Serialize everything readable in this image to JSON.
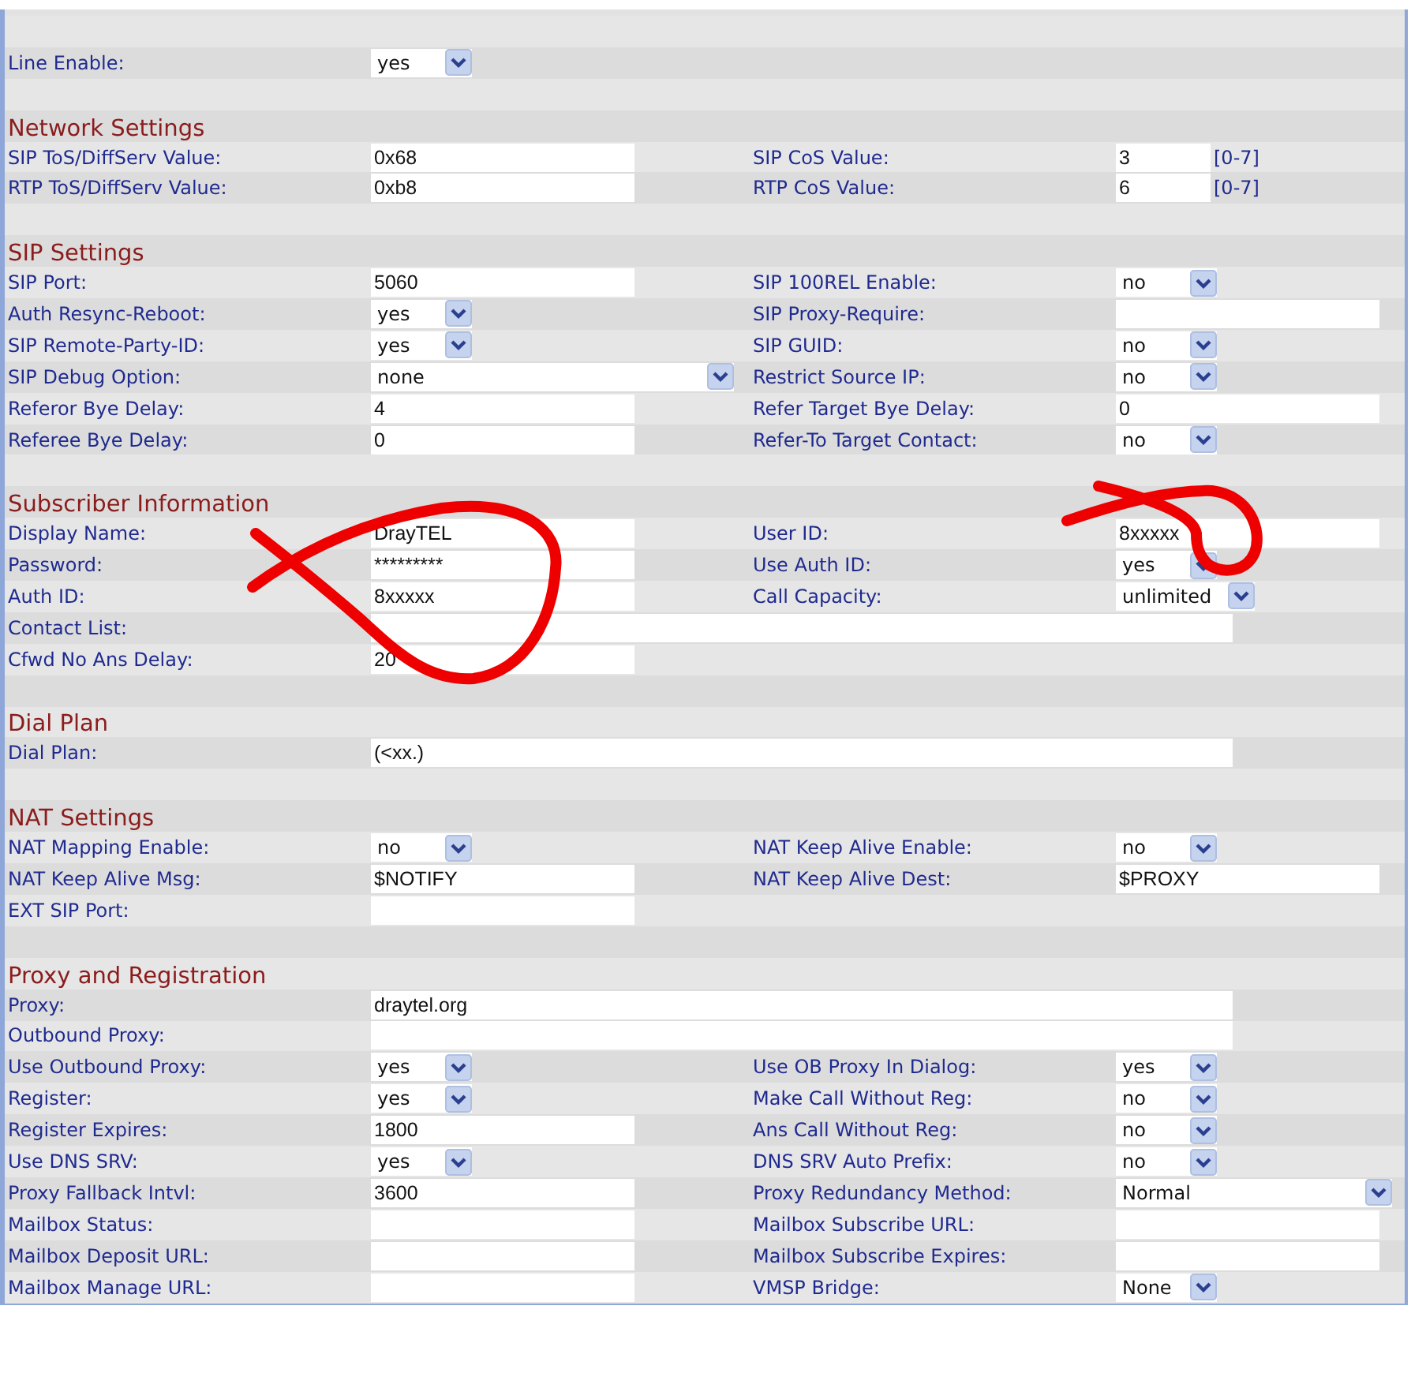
{
  "sections": [
    {
      "rows": [
        {
          "left": {
            "label": "Line Enable:",
            "control": {
              "kind": "select",
              "value": "yes"
            }
          }
        }
      ]
    },
    {
      "title": "Network Settings",
      "rows": [
        {
          "left": {
            "label": "SIP ToS/DiffServ Value:",
            "control": {
              "kind": "text",
              "value": "0x68"
            }
          },
          "right": {
            "label": "SIP CoS Value:",
            "control": {
              "kind": "text-short",
              "value": "3",
              "suffix": "[0-7]"
            }
          }
        },
        {
          "left": {
            "label": "RTP ToS/DiffServ Value:",
            "control": {
              "kind": "text",
              "value": "0xb8"
            }
          },
          "right": {
            "label": "RTP CoS Value:",
            "control": {
              "kind": "text-short",
              "value": "6",
              "suffix": "[0-7]"
            }
          }
        }
      ]
    },
    {
      "title": "SIP Settings",
      "rows": [
        {
          "left": {
            "label": "SIP Port:",
            "control": {
              "kind": "text",
              "value": "5060"
            }
          },
          "right": {
            "label": "SIP 100REL Enable:",
            "control": {
              "kind": "select",
              "value": "no"
            }
          }
        },
        {
          "left": {
            "label": "Auth Resync-Reboot:",
            "control": {
              "kind": "select",
              "value": "yes"
            }
          },
          "right": {
            "label": "SIP Proxy-Require:",
            "control": {
              "kind": "text"
            }
          }
        },
        {
          "left": {
            "label": "SIP Remote-Party-ID:",
            "control": {
              "kind": "select",
              "value": "yes"
            }
          },
          "right": {
            "label": "SIP GUID:",
            "control": {
              "kind": "select",
              "value": "no"
            }
          }
        },
        {
          "left": {
            "label": "SIP Debug Option:",
            "control": {
              "kind": "select-long",
              "value": "none"
            }
          },
          "right": {
            "label": "Restrict Source IP:",
            "control": {
              "kind": "select",
              "value": "no"
            }
          }
        },
        {
          "left": {
            "label": "Referor Bye Delay:",
            "control": {
              "kind": "text",
              "value": "4"
            }
          },
          "right": {
            "label": "Refer Target Bye Delay:",
            "control": {
              "kind": "text",
              "value": "0"
            }
          }
        },
        {
          "left": {
            "label": "Referee Bye Delay:",
            "control": {
              "kind": "text",
              "value": "0"
            }
          },
          "right": {
            "label": "Refer-To Target Contact:",
            "control": {
              "kind": "select",
              "value": "no"
            }
          }
        }
      ]
    },
    {
      "title": "Subscriber Information",
      "rows": [
        {
          "left": {
            "label": "Display Name:",
            "control": {
              "kind": "text",
              "value": "DrayTEL"
            }
          },
          "right": {
            "label": "User ID:",
            "control": {
              "kind": "text",
              "value": "8xxxxx"
            }
          }
        },
        {
          "left": {
            "label": "Password:",
            "control": {
              "kind": "text",
              "value": "*********"
            }
          },
          "right": {
            "label": "Use Auth ID:",
            "control": {
              "kind": "select",
              "value": "yes"
            }
          }
        },
        {
          "left": {
            "label": "Auth ID:",
            "control": {
              "kind": "text",
              "value": "8xxxxx"
            }
          },
          "right": {
            "label": "Call Capacity:",
            "control": {
              "kind": "select",
              "value": "unlimited"
            }
          }
        },
        {
          "left": {
            "label": "Contact List:",
            "control": {
              "kind": "text-long"
            }
          }
        },
        {
          "left": {
            "label": "Cfwd No Ans Delay:",
            "control": {
              "kind": "text",
              "value": "20"
            }
          }
        }
      ]
    },
    {
      "title": "Dial Plan",
      "rows": [
        {
          "left": {
            "label": "Dial Plan:",
            "control": {
              "kind": "text-long",
              "value": "(<xx.)"
            }
          }
        }
      ]
    },
    {
      "title": "NAT Settings",
      "rows": [
        {
          "left": {
            "label": "NAT Mapping Enable:",
            "control": {
              "kind": "select",
              "value": "no"
            }
          },
          "right": {
            "label": "NAT Keep Alive Enable:",
            "control": {
              "kind": "select",
              "value": "no"
            }
          }
        },
        {
          "left": {
            "label": "NAT Keep Alive Msg:",
            "control": {
              "kind": "text",
              "value": "$NOTIFY"
            }
          },
          "right": {
            "label": "NAT Keep Alive Dest:",
            "control": {
              "kind": "text",
              "value": "$PROXY"
            }
          }
        },
        {
          "left": {
            "label": "EXT SIP Port:",
            "control": {
              "kind": "text"
            }
          }
        }
      ]
    },
    {
      "title": "Proxy and Registration",
      "rows": [
        {
          "left": {
            "label": "Proxy:",
            "control": {
              "kind": "text-long",
              "value": "draytel.org"
            }
          }
        },
        {
          "left": {
            "label": "Outbound Proxy:",
            "control": {
              "kind": "text-long"
            }
          }
        },
        {
          "left": {
            "label": "Use Outbound Proxy:",
            "control": {
              "kind": "select",
              "value": "yes"
            }
          },
          "right": {
            "label": "Use OB Proxy In Dialog:",
            "control": {
              "kind": "select",
              "value": "yes"
            }
          }
        },
        {
          "left": {
            "label": "Register:",
            "control": {
              "kind": "select",
              "value": "yes"
            }
          },
          "right": {
            "label": "Make Call Without Reg:",
            "control": {
              "kind": "select",
              "value": "no"
            }
          }
        },
        {
          "left": {
            "label": "Register Expires:",
            "control": {
              "kind": "text",
              "value": "1800"
            }
          },
          "right": {
            "label": "Ans Call Without Reg:",
            "control": {
              "kind": "select",
              "value": "no"
            }
          }
        },
        {
          "left": {
            "label": "Use DNS SRV:",
            "control": {
              "kind": "select",
              "value": "yes"
            }
          },
          "right": {
            "label": "DNS SRV Auto Prefix:",
            "control": {
              "kind": "select",
              "value": "no"
            }
          }
        },
        {
          "left": {
            "label": "Proxy Fallback Intvl:",
            "control": {
              "kind": "text",
              "value": "3600"
            }
          },
          "right": {
            "label": "Proxy Redundancy Method:",
            "control": {
              "kind": "select-long",
              "value": "Normal"
            }
          }
        },
        {
          "left": {
            "label": "Mailbox Status:",
            "control": {
              "kind": "text"
            }
          },
          "right": {
            "label": "Mailbox Subscribe URL:",
            "control": {
              "kind": "text"
            }
          }
        },
        {
          "left": {
            "label": "Mailbox Deposit URL:",
            "control": {
              "kind": "text"
            }
          },
          "right": {
            "label": "Mailbox Subscribe Expires:",
            "control": {
              "kind": "text"
            }
          }
        },
        {
          "left": {
            "label": "Mailbox Manage URL:",
            "control": {
              "kind": "text"
            }
          },
          "right": {
            "label": "VMSP Bridge:",
            "control": {
              "kind": "select",
              "value": "None"
            }
          }
        }
      ]
    }
  ]
}
